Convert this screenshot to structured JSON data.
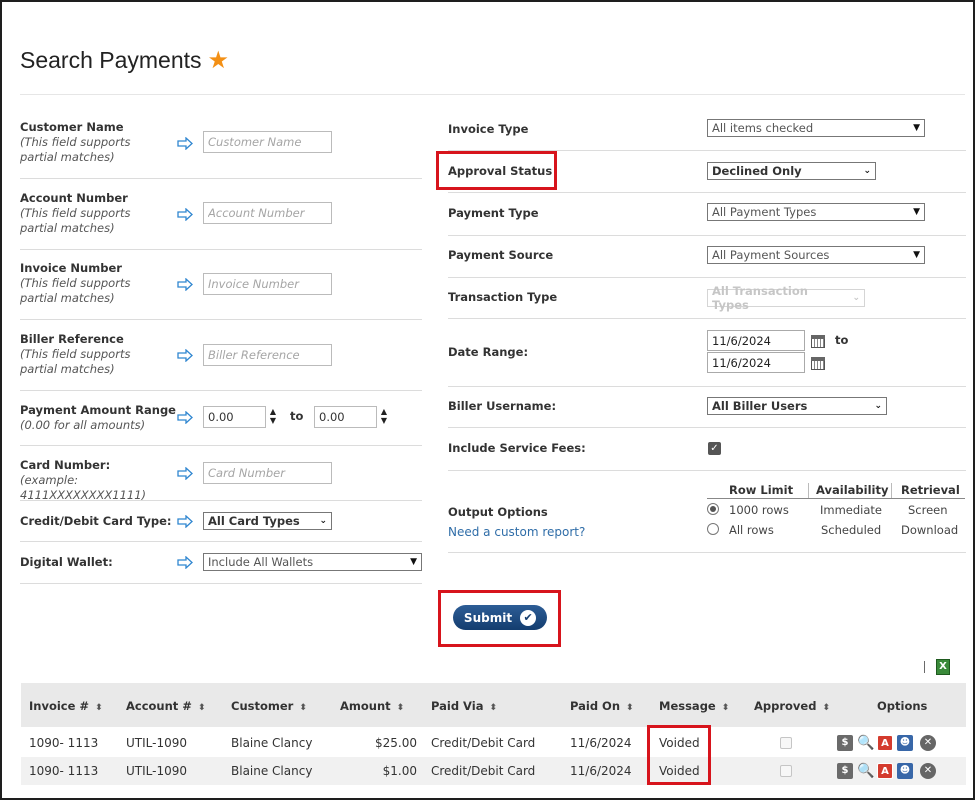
{
  "page": {
    "title": "Search Payments"
  },
  "left_form": {
    "customer_name": {
      "label": "Customer Name",
      "hint": "(This field supports partial matches)",
      "placeholder": "Customer Name"
    },
    "account_number": {
      "label": "Account Number",
      "hint": "(This field supports partial matches)",
      "placeholder": "Account Number"
    },
    "invoice_number": {
      "label": "Invoice Number",
      "hint": "(This field supports partial matches)",
      "placeholder": "Invoice Number"
    },
    "biller_reference": {
      "label": "Biller Reference",
      "hint": "(This field supports partial matches)",
      "placeholder": "Biller Reference"
    },
    "payment_amount_range": {
      "label": "Payment Amount Range",
      "hint": "(0.00 for all amounts)",
      "from": "0.00",
      "to_label": "to",
      "to": "0.00"
    },
    "card_number": {
      "label": "Card Number:",
      "hint": "(example: 4111XXXXXXXX1111)",
      "placeholder": "Card Number"
    },
    "card_type": {
      "label": "Credit/Debit Card Type:",
      "value": "All Card Types"
    },
    "digital_wallet": {
      "label": "Digital Wallet:",
      "value": "Include All Wallets"
    }
  },
  "right_form": {
    "invoice_type": {
      "label": "Invoice Type",
      "value": "All items checked"
    },
    "approval_status": {
      "label": "Approval Status",
      "value": "Declined Only"
    },
    "payment_type": {
      "label": "Payment Type",
      "value": "All Payment Types"
    },
    "payment_source": {
      "label": "Payment Source",
      "value": "All Payment Sources"
    },
    "transaction_type": {
      "label": "Transaction Type",
      "value": "All Transaction Types"
    },
    "date_range": {
      "label": "Date Range:",
      "from": "11/6/2024",
      "to_label": "to",
      "to": "11/6/2024"
    },
    "biller_username": {
      "label": "Biller Username:",
      "value": "All Biller Users"
    },
    "service_fees": {
      "label": "Include Service Fees:",
      "checked": true
    },
    "output_options": {
      "label": "Output Options",
      "link": "Need a custom report?",
      "headers": [
        "Row Limit",
        "Availability",
        "Retrieval"
      ],
      "rows": [
        {
          "limit": "1000 rows",
          "availability": "Immediate",
          "retrieval": "Screen",
          "selected": true
        },
        {
          "limit": "All rows",
          "availability": "Scheduled",
          "retrieval": "Download",
          "selected": false
        }
      ]
    }
  },
  "submit": {
    "label": "Submit"
  },
  "table": {
    "headers": [
      "Invoice #",
      "Account #",
      "Customer",
      "Amount",
      "Paid Via",
      "Paid On",
      "Message",
      "Approved",
      "Options"
    ],
    "rows": [
      {
        "invoice": "1090- 1113",
        "account": "UTIL-1090",
        "customer": "Blaine Clancy",
        "amount": "$25.00",
        "paid_via": "Credit/Debit Card",
        "paid_on": "11/6/2024",
        "message": "Voided"
      },
      {
        "invoice": "1090- 1113",
        "account": "UTIL-1090",
        "customer": "Blaine Clancy",
        "amount": "$1.00",
        "paid_via": "Credit/Debit Card",
        "paid_on": "11/6/2024",
        "message": "Voided"
      }
    ]
  },
  "colors": {
    "accent_star": "#f39015",
    "highlight_red": "#d7141c",
    "submit_blue": "#143d6f",
    "link_blue": "#2f6da8"
  }
}
